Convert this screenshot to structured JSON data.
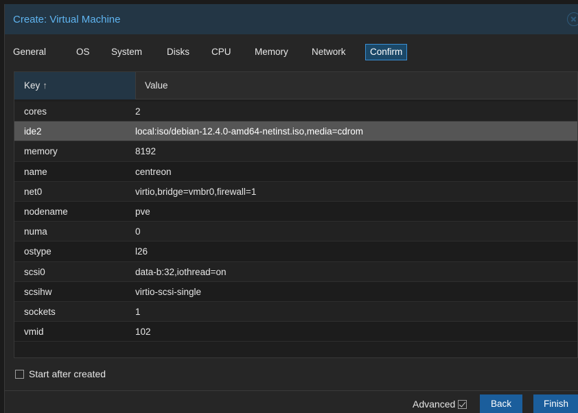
{
  "window": {
    "title": "Create: Virtual Machine"
  },
  "tabs": [
    {
      "label": "General"
    },
    {
      "label": "OS"
    },
    {
      "label": "System"
    },
    {
      "label": "Disks"
    },
    {
      "label": "CPU"
    },
    {
      "label": "Memory"
    },
    {
      "label": "Network"
    },
    {
      "label": "Confirm",
      "active": true
    }
  ],
  "grid": {
    "columns": {
      "key": "Key",
      "value": "Value"
    },
    "sort_indicator": "↑",
    "selected_row": "ide2",
    "rows": [
      {
        "key": "cores",
        "value": "2"
      },
      {
        "key": "ide2",
        "value": "local:iso/debian-12.4.0-amd64-netinst.iso,media=cdrom"
      },
      {
        "key": "memory",
        "value": "8192"
      },
      {
        "key": "name",
        "value": "centreon"
      },
      {
        "key": "net0",
        "value": "virtio,bridge=vmbr0,firewall=1"
      },
      {
        "key": "nodename",
        "value": "pve"
      },
      {
        "key": "numa",
        "value": "0"
      },
      {
        "key": "ostype",
        "value": "l26"
      },
      {
        "key": "scsi0",
        "value": "data-b:32,iothread=on"
      },
      {
        "key": "scsihw",
        "value": "virtio-scsi-single"
      },
      {
        "key": "sockets",
        "value": "1"
      },
      {
        "key": "vmid",
        "value": "102"
      }
    ]
  },
  "start_after_created": {
    "label": "Start after created",
    "checked": false
  },
  "footer": {
    "advanced_label": "Advanced",
    "advanced_checked": true,
    "back_label": "Back",
    "finish_label": "Finish"
  },
  "colors": {
    "title": "#5fb4f0",
    "titlebar_bg": "#233645",
    "button_bg": "#1b5e9c",
    "active_tab_border": "#3a8fd4",
    "selected_row_bg": "#555555"
  }
}
